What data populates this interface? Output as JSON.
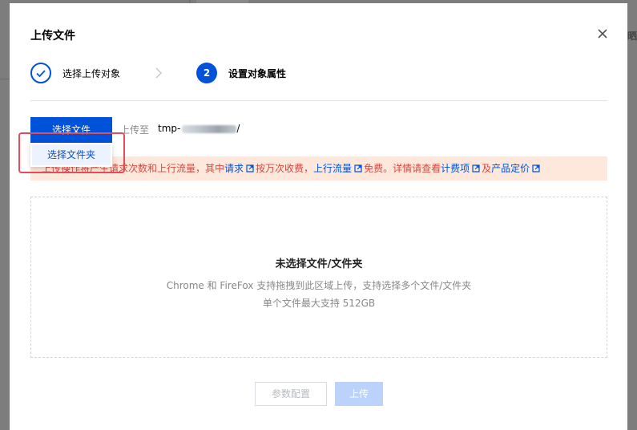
{
  "background": {
    "right_edge_text": "欢晒"
  },
  "modal": {
    "title": "上传文件",
    "close_icon": "close-icon"
  },
  "steps": [
    {
      "label": "选择上传对象",
      "state": "done",
      "icon": "check-icon"
    },
    {
      "number": "2",
      "label": "设置对象属性",
      "state": "active"
    }
  ],
  "toolbar": {
    "select_file_label": "选择文件",
    "upload_to_label": "上传至",
    "bucket_path_prefix": "tmp-",
    "bucket_path_suffix": "/"
  },
  "dropdown": {
    "items": [
      {
        "label": "选择文件夹"
      }
    ]
  },
  "notice": {
    "text_1": "上传操作将产生请求次数和上行流量，其中",
    "link_requests": "请求",
    "text_2": "按万次收费，",
    "link_upstream": "上行流量",
    "text_3": "免费。详情请查看",
    "link_billing": "计费项",
    "text_4": "及",
    "link_pricing": "产品定价"
  },
  "dropzone": {
    "title": "未选择文件/文件夹",
    "desc_line1": "Chrome 和 FireFox 支持拖拽到此区域上传，支持选择多个文件/文件夹",
    "desc_line2": "单个文件最大支持 512GB"
  },
  "footer": {
    "params_label": "参数配置",
    "upload_label": "上传"
  },
  "colors": {
    "primary": "#0052d9",
    "notice_bg": "#fde8db",
    "notice_text": "#d54941",
    "highlight": "#e34d59",
    "disabled_primary": "#bbd3fb"
  }
}
